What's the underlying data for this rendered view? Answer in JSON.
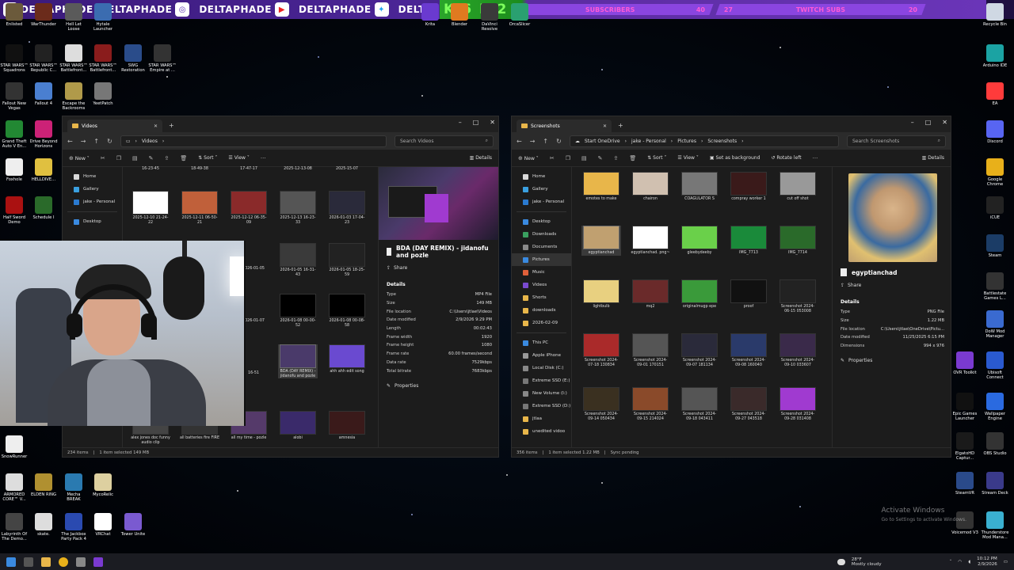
{
  "banner": {
    "handles": [
      "DELTAPHADE",
      "DELTAPHADE",
      "DELTAPHADE",
      "DELTAPHADE",
      "DELTAPHADEX"
    ],
    "stats_big": [
      "K",
      "6",
      "P",
      "2"
    ],
    "stat_segments": [
      {
        "value": "6",
        "label": "SUBSCRIBERS",
        "goal": "40"
      },
      {
        "value": "27",
        "label": "TWITCH SUBS",
        "goal": "20"
      }
    ]
  },
  "desktop_icons_left": [
    {
      "label": "Enlisted",
      "color": "#6b5a3b"
    },
    {
      "label": "WarThunder",
      "color": "#6b2b1b"
    },
    {
      "label": "Hell Let Loose",
      "color": "#5a5a5a"
    },
    {
      "label": "Hytale Launcher",
      "color": "#3b6cb0"
    },
    {
      "label": "STAR WARS™ Squadrons",
      "color": "#111111"
    },
    {
      "label": "STAR WARS™ Republic C...",
      "color": "#222222"
    },
    {
      "label": "STAR WARS™ Battlefront...",
      "color": "#dddddd"
    },
    {
      "label": "STAR WARS™ Battlefront...",
      "color": "#8a1c1c"
    },
    {
      "label": "SWG Restoration",
      "color": "#2a4c8a"
    },
    {
      "label": "STAR WARS™ Empire at ...",
      "color": "#333333"
    },
    {
      "label": "Fallout New Vegas",
      "color": "#333333"
    },
    {
      "label": "Fallout 4",
      "color": "#4a7fd0"
    },
    {
      "label": "Escape the Backrooms",
      "color": "#b09a4a"
    },
    {
      "label": "YeetPatch",
      "color": "#777777"
    },
    {
      "label": "Grand Theft Auto V En...",
      "color": "#228833"
    },
    {
      "label": "Drive Beyond Horizons",
      "color": "#cc2277"
    },
    {
      "label": "Foxhole",
      "color": "#eeeeee"
    },
    {
      "label": "HELLDIVE...",
      "color": "#e0c040"
    },
    {
      "label": "Half Sword Demo",
      "color": "#aa1111"
    },
    {
      "label": "Schedule I",
      "color": "#2a6a2a"
    },
    {
      "label": "SnowRunner",
      "color": "#eeeeee"
    },
    {
      "label": "ARMORED CORE™ V...",
      "color": "#dddddd"
    },
    {
      "label": "ELDEN RING",
      "color": "#b09030"
    },
    {
      "label": "Mecha BREAK",
      "color": "#2a7ab0"
    },
    {
      "label": "MycoRelic",
      "color": "#ddd0a0"
    },
    {
      "label": "Labyrinth Of The Demo...",
      "color": "#444444"
    },
    {
      "label": "skate.",
      "color": "#dddddd"
    },
    {
      "label": "The Jackbox Party Pack 4",
      "color": "#2a4ab0"
    },
    {
      "label": "VRChat",
      "color": "#ffffff"
    },
    {
      "label": "Tower Unite",
      "color": "#7a5ad0"
    }
  ],
  "desktop_icons_top": [
    {
      "label": "Krita",
      "color": "#6a3ad0"
    },
    {
      "label": "Blender",
      "color": "#e07a20"
    },
    {
      "label": "DaVinci Resolve",
      "color": "#3a3a3a"
    },
    {
      "label": "OrcaSlicer",
      "color": "#2aa070"
    }
  ],
  "desktop_icons_right": [
    {
      "label": "Recycle Bin",
      "color": "#cfd8e3"
    },
    {
      "label": "Arduino IDE",
      "color": "#1ba3a3"
    },
    {
      "label": "EA",
      "color": "#ff3b3b"
    },
    {
      "label": "Discord",
      "color": "#5865f2"
    },
    {
      "label": "Google Chrome",
      "color": "#e8b01a"
    },
    {
      "label": "iCUE",
      "color": "#222222"
    },
    {
      "label": "Steam",
      "color": "#1b3c66"
    },
    {
      "label": "Battlestate Games L...",
      "color": "#333333"
    },
    {
      "label": "DoW Mod Manager",
      "color": "#3a6ad0"
    },
    {
      "label": "Ubisoft Connect",
      "color": "#2a5ad0"
    },
    {
      "label": "OVR Toolkit",
      "color": "#7a3ad0"
    },
    {
      "label": "Wallpaper Engine",
      "color": "#2a6ae0"
    },
    {
      "label": "Epic Games Launcher",
      "color": "#111111"
    },
    {
      "label": "OBS Studio",
      "color": "#333333"
    },
    {
      "label": "ElgatoHD Captur...",
      "color": "#1a1a1a"
    },
    {
      "label": "Stream Deck",
      "color": "#3a3a8a"
    },
    {
      "label": "SteamVR",
      "color": "#2a4a8a"
    },
    {
      "label": "Thunderstore Mod Mana...",
      "color": "#3ab0d0"
    },
    {
      "label": "Voicemod V3",
      "color": "#333333"
    },
    {
      "label": "Learn about this picture",
      "color": "#444444"
    }
  ],
  "videos_window": {
    "tab_title": "Videos",
    "path": [
      "Videos"
    ],
    "search_placeholder": "Search Videos",
    "toolbar": {
      "new": "New",
      "sort": "Sort",
      "view": "View",
      "details": "Details"
    },
    "nav": [
      "Home",
      "Gallery",
      "jake - Personal",
      "Desktop"
    ],
    "top_labels": [
      "16-23-45",
      "18-49-38",
      "17-47-17",
      "2025-12-13-08",
      "2025-15-07"
    ],
    "thumbs": [
      {
        "label": "2025-12-10 21-24-22",
        "color": "#ffffff"
      },
      {
        "label": "2025-12-11 06-50-21",
        "color": "#c0603a"
      },
      {
        "label": "2025-12-12 06-35-09",
        "color": "#8a2a2a"
      },
      {
        "label": "2025-12-13 16-23-33",
        "color": "#555555"
      },
      {
        "label": "2026-01-03 17-04-23",
        "color": "#2a2a3a"
      },
      {
        "label": "2026-01-05 16-31-43",
        "color": "#3a3a3a"
      },
      {
        "label": "2026-01-05 18-25-59",
        "color": "#222222"
      },
      {
        "label": "2026-01-08 00-00-52",
        "color": "#000000"
      },
      {
        "label": "2026-01-08 00-08-58",
        "color": "#000000"
      },
      {
        "label": "BDA (DAY REMIX) - jidanofu and pozle",
        "color": "#4a3a6a"
      },
      {
        "label": "ahh ahh edit song",
        "color": "#6a4ad0"
      },
      {
        "label": "alex jones doc funny audio clip",
        "color": "#444444"
      },
      {
        "label": "all batteries fire FIRE",
        "color": "#333333"
      },
      {
        "label": "all my time - pozle",
        "color": "#553a6a"
      },
      {
        "label": "alobi",
        "color": "#3a2a6a"
      },
      {
        "label": "amnesia",
        "color": "#3a1a1a"
      }
    ],
    "left_partials": [
      "2026-01-05",
      "2026-01-07",
      "16-51"
    ],
    "side_folders": [
      "jtlaa",
      "unedited vidoo"
    ],
    "details": {
      "title": "BDA (DAY REMIX) - jidanofu and pozle",
      "share": "Share",
      "heading": "Details",
      "rows": [
        {
          "k": "Type",
          "v": "MP4 File"
        },
        {
          "k": "Size",
          "v": "149 MB"
        },
        {
          "k": "File location",
          "v": "C:\\Users\\jtlae\\Videos"
        },
        {
          "k": "Date modified",
          "v": "2/9/2026 9:29 PM"
        },
        {
          "k": "Length",
          "v": "00:02:43"
        },
        {
          "k": "Frame width",
          "v": "1920"
        },
        {
          "k": "Frame height",
          "v": "1080"
        },
        {
          "k": "Frame rate",
          "v": "60.00 frames/second"
        },
        {
          "k": "Data rate",
          "v": "7529kbps"
        },
        {
          "k": "Total bitrate",
          "v": "7683kbps"
        }
      ],
      "properties": "Properties"
    },
    "status": [
      "234 items",
      "1 item selected 149 MB"
    ]
  },
  "screenshots_window": {
    "tab_title": "Screenshots",
    "path": [
      "Start OneDrive",
      "jake - Personal",
      "Pictures",
      "Screenshots"
    ],
    "search_placeholder": "Search Screenshots",
    "toolbar": {
      "new": "New",
      "sort": "Sort",
      "view": "View",
      "set_bg": "Set as background",
      "rotate": "Rotate left",
      "details": "Details"
    },
    "nav": [
      "Home",
      "Gallery",
      "jake - Personal",
      "Desktop",
      "Downloads",
      "Documents",
      "Pictures",
      "Music",
      "Videos",
      "Shorts",
      "downloads",
      "2026-02-09",
      "This PC",
      "Apple iPhone",
      "Local Disk (C:)",
      "Extreme SSD (E:)",
      "New Volume (I:)",
      "Extreme SSD (D:)",
      "jtlaa",
      "unedited vidoo"
    ],
    "thumbs": [
      {
        "label": "emotes to make",
        "color": "#e8b64a"
      },
      {
        "label": "chairon",
        "color": "#d0c0b0"
      },
      {
        "label": "COAGULATOR S",
        "color": "#777777"
      },
      {
        "label": "compray worker 1",
        "color": "#3a1a1a"
      },
      {
        "label": "cut off shot",
        "color": "#999999"
      },
      {
        "label": "egyptianchad",
        "color": "#c0a070"
      },
      {
        "label": "egyptianchad. png~",
        "color": "#ffffff"
      },
      {
        "label": "gleebydeeby",
        "color": "#6ad04a"
      },
      {
        "label": "IMG_7713",
        "color": "#1a8a3a"
      },
      {
        "label": "IMG_7714",
        "color": "#2a6a2a"
      },
      {
        "label": "lightbulb",
        "color": "#e8d080"
      },
      {
        "label": "mq2",
        "color": "#6a2a2a"
      },
      {
        "label": "originalmugp epe",
        "color": "#3a9a3a"
      },
      {
        "label": "proof",
        "color": "#111111"
      },
      {
        "label": "Screenshot 2024-06-15 053008",
        "color": "#222222"
      },
      {
        "label": "Screenshot 2024-07-18 130834",
        "color": "#aa2a2a"
      },
      {
        "label": "Screenshot 2024-09-01 170151",
        "color": "#555555"
      },
      {
        "label": "Screenshot 2024-09-07 181134",
        "color": "#2a2a3a"
      },
      {
        "label": "Screenshot 2024-09-08 160040",
        "color": "#2a3a6a"
      },
      {
        "label": "Screenshot 2024-09-10 033607",
        "color": "#3a2a4a"
      },
      {
        "label": "Screenshot 2024-09-14 050434",
        "color": "#3a3020"
      },
      {
        "label": "Screenshot 2024-09-15 214024",
        "color": "#8a4a2a"
      },
      {
        "label": "Screenshot 2024-09-18 043411",
        "color": "#555555"
      },
      {
        "label": "Screenshot 2024-09-27 043518",
        "color": "#3a2a2a"
      },
      {
        "label": "Screenshot 2024-09-28 031408",
        "color": "#a03ad0"
      }
    ],
    "details": {
      "title": "egyptianchad",
      "share": "Share",
      "heading": "Details",
      "rows": [
        {
          "k": "Type",
          "v": "PNG File"
        },
        {
          "k": "Size",
          "v": "1.22 MB"
        },
        {
          "k": "File location",
          "v": "C:\\Users\\jtlae\\OneDrive\\Pictu..."
        },
        {
          "k": "Date modified",
          "v": "11/25/2025 6:15 PM"
        },
        {
          "k": "Dimensions",
          "v": "994 x 976"
        }
      ],
      "properties": "Properties"
    },
    "status": [
      "356 items",
      "1 item selected 1.22 MB",
      "Sync pending"
    ]
  },
  "activate": {
    "title": "Activate Windows",
    "sub": "Go to Settings to activate Windows."
  },
  "taskbar": {
    "weather_temp": "28°F",
    "weather_desc": "Mostly cloudy",
    "time": "10:12 PM",
    "date": "2/9/2026"
  }
}
